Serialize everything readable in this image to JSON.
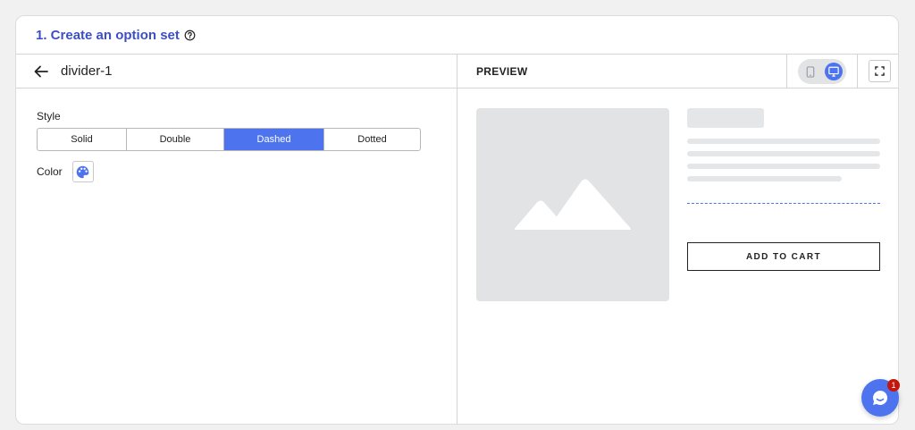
{
  "header": {
    "title": "1. Create an option set",
    "help_icon": "question-circle-icon"
  },
  "editor": {
    "back_icon": "arrow-left-icon",
    "item_name": "divider-1",
    "style_label": "Style",
    "style_options": [
      "Solid",
      "Double",
      "Dashed",
      "Dotted"
    ],
    "style_selected": "Dashed",
    "color_label": "Color",
    "color_icon": "palette-icon"
  },
  "preview": {
    "label": "PREVIEW",
    "device_mobile_icon": "mobile-icon",
    "device_desktop_icon": "desktop-icon",
    "device_selected": "desktop",
    "fullscreen_icon": "expand-icon",
    "image_icon": "image-placeholder-icon",
    "add_to_cart": "ADD TO CART"
  },
  "chat": {
    "icon": "chat-icon",
    "badge": "1"
  },
  "colors": {
    "accent": "#4d73ef",
    "title": "#3d4fc4",
    "badge": "#c4170c"
  }
}
